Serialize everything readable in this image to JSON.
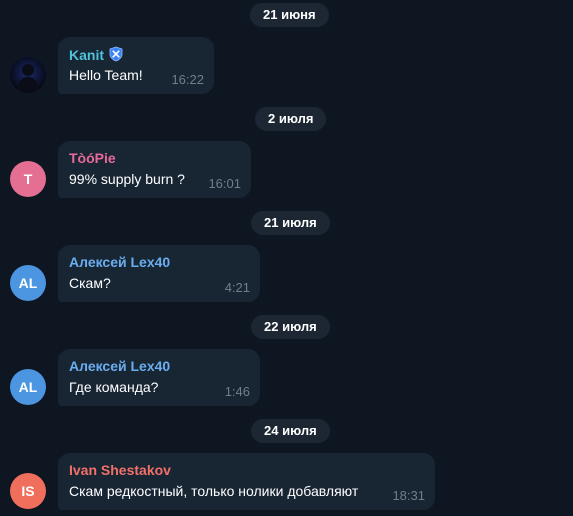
{
  "colors": {
    "background": "#0e1621",
    "bubble": "#182533",
    "date_pill": "#1c2733",
    "time": "#6d7f8f"
  },
  "dates": [
    "21 июня",
    "2 июля",
    "21 июля",
    "22 июля",
    "24 июля"
  ],
  "messages": [
    {
      "sender": "Kanit",
      "sender_color": "#4fc3d9",
      "avatar_type": "image",
      "avatar_icon": "dark-figure-avatar",
      "badge_icon": "x-shield-badge-icon",
      "text": "Hello Team!",
      "time": "16:22"
    },
    {
      "sender": "TòóPie",
      "sender_color": "#e86a9a",
      "avatar_initials": "T",
      "avatar_color": "#e56f92",
      "text": "99% supply burn ?",
      "time": "16:01"
    },
    {
      "sender": "Алексей Lex40",
      "sender_color": "#6aaef0",
      "avatar_initials": "AL",
      "avatar_color": "#4c95e0",
      "text": "Скам?",
      "time": "4:21"
    },
    {
      "sender": "Алексей Lex40",
      "sender_color": "#6aaef0",
      "avatar_initials": "AL",
      "avatar_color": "#4c95e0",
      "text": "Где команда?",
      "time": "1:46"
    },
    {
      "sender": "Ivan Shestakov",
      "sender_color": "#f2706a",
      "avatar_initials": "IS",
      "avatar_color": "#ef6f5c",
      "text": "Скам редкостный, только нолики добавляют",
      "time": "18:31"
    }
  ]
}
